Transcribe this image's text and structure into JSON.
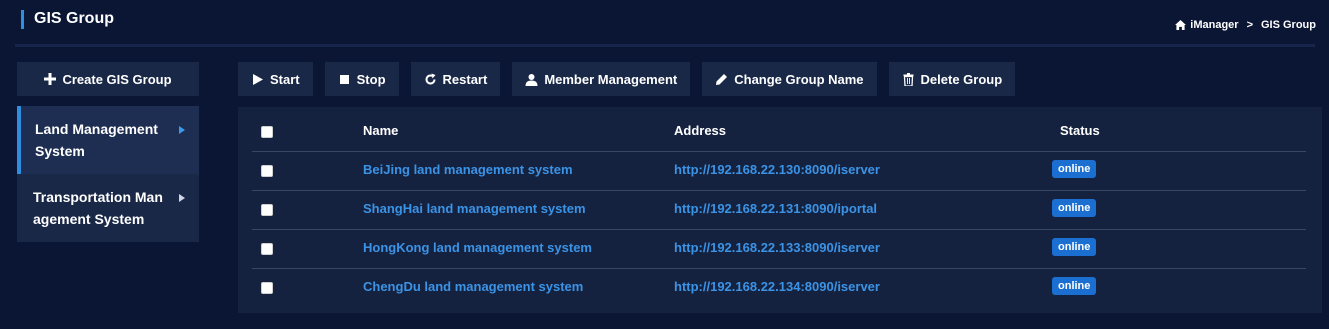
{
  "header": {
    "title": "GIS Group",
    "breadcrumb": {
      "home": "iManager",
      "separator": ">",
      "current": "GIS Group"
    }
  },
  "sidebar": {
    "create_label": "Create GIS Group",
    "items": [
      {
        "label_line1": "Land Management",
        "label_line2": "System",
        "active": true
      },
      {
        "label_line1": "Transportation Man",
        "label_line2": "agement System",
        "active": false
      }
    ]
  },
  "toolbar": {
    "start": "Start",
    "stop": "Stop",
    "restart": "Restart",
    "member_management": "Member Management",
    "change_group_name": "Change Group Name",
    "delete_group": "Delete Group"
  },
  "table": {
    "columns": [
      "Name",
      "Address",
      "Status"
    ],
    "rows": [
      {
        "name": "BeiJing land management system",
        "address": "http://192.168.22.130:8090/iserver",
        "status": "online"
      },
      {
        "name": "ShangHai land management system",
        "address": "http://192.168.22.131:8090/iportal",
        "status": "online"
      },
      {
        "name": "HongKong land management system",
        "address": "http://192.168.22.133:8090/iserver",
        "status": "online"
      },
      {
        "name": "ChengDu land management system",
        "address": "http://192.168.22.134:8090/iserver",
        "status": "online"
      }
    ]
  },
  "colors": {
    "background": "#0b1534",
    "panel": "#15223f",
    "accent": "#2f8ee0",
    "link": "#3b93e6",
    "badge": "#1b6fd1"
  },
  "icons": [
    "home-icon",
    "plus-icon",
    "play-icon",
    "stop-icon",
    "refresh-icon",
    "user-icon",
    "pencil-icon",
    "trash-icon",
    "chevron-right-icon"
  ]
}
